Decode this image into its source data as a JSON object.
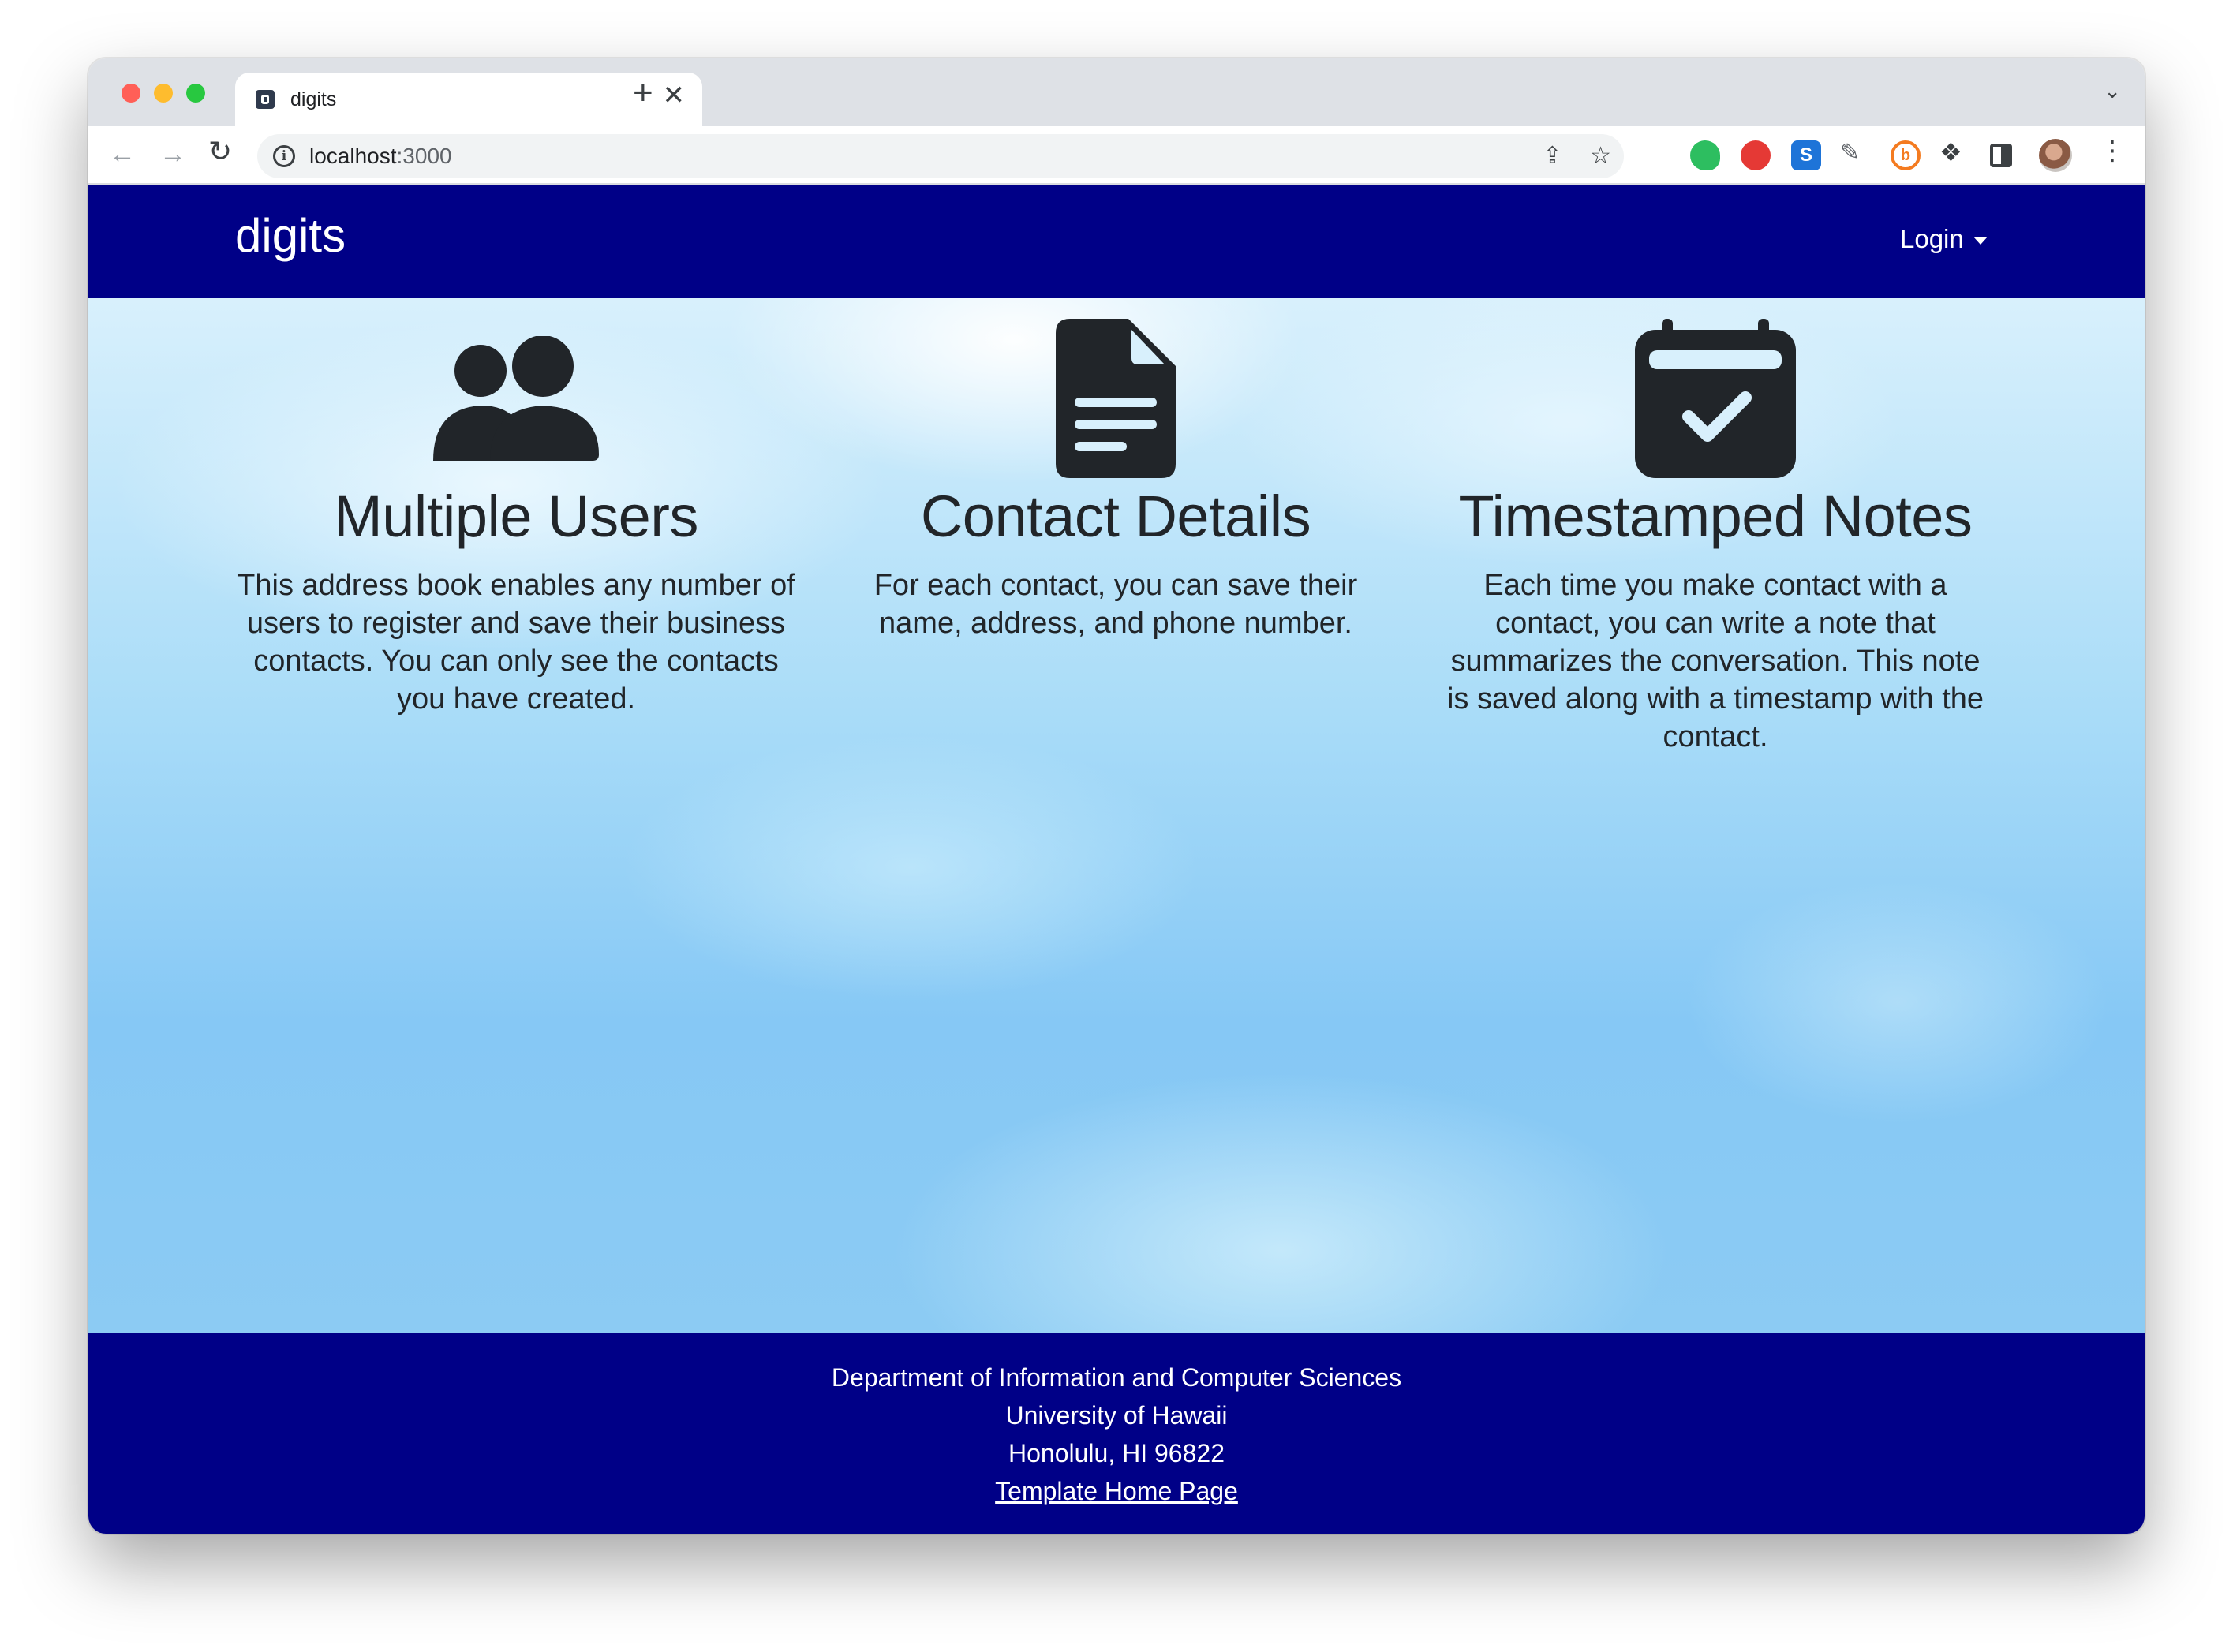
{
  "browser": {
    "tab_title": "digits",
    "tab_close": "✕",
    "new_tab": "+",
    "url_host": "localhost",
    "url_port": ":3000"
  },
  "navbar": {
    "brand": "digits",
    "login_label": "Login"
  },
  "features": [
    {
      "icon": "users-icon",
      "title": "Multiple Users",
      "text": "This address book enables any number of users to register and save their business contacts. You can only see the contacts you have created."
    },
    {
      "icon": "file-lines-icon",
      "title": "Contact Details",
      "text": "For each contact, you can save their name, address, and phone number."
    },
    {
      "icon": "calendar-check-icon",
      "title": "Timestamped Notes",
      "text": "Each time you make contact with a contact, you can write a note that summarizes the conversation. This note is saved along with a timestamp with the contact."
    }
  ],
  "footer": {
    "line1": "Department of Information and Computer Sciences",
    "line2": "University of Hawaii",
    "line3": "Honolulu, HI 96822",
    "link": "Template Home Page"
  },
  "colors": {
    "navbar_bg": "#000087",
    "footer_bg": "#000087",
    "icon_color": "#212529"
  }
}
